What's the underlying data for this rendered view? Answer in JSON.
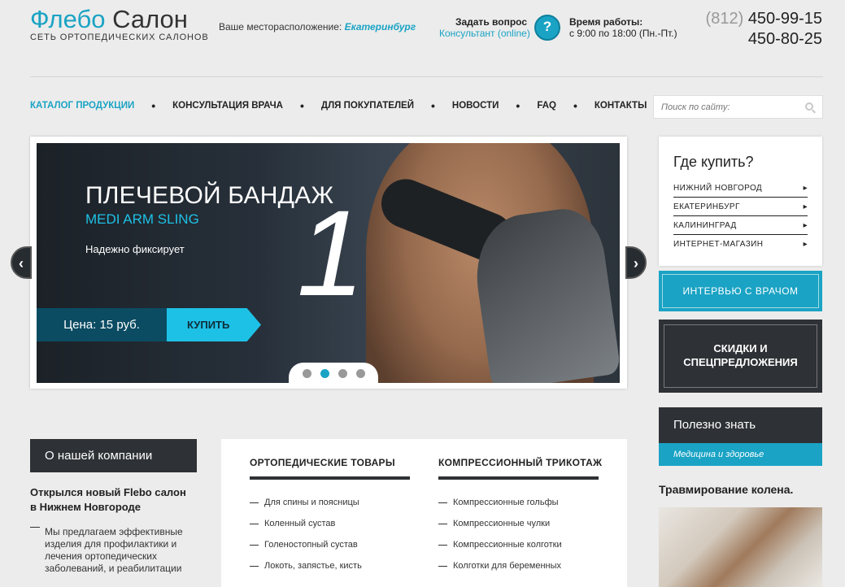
{
  "header": {
    "brand_part1": "Флебо",
    "brand_part2": "Салон",
    "tagline": "СЕТЬ ОРТОПЕДИЧЕСКИХ САЛОНОВ",
    "location_label": "Ваше месторасположение:",
    "location_city": "Екатеринбург",
    "ask_title": "Задать вопрос",
    "ask_subtitle": "Консультант (online)",
    "hours_title": "Время работы:",
    "hours_value": "с 9:00 по 18:00 (Пн.-Пт.)",
    "phone_code": "(812)",
    "phone1": "450-99-15",
    "phone2": "450-80-25"
  },
  "nav": {
    "items": [
      "КАТАЛОГ ПРОДУКЦИИ",
      "КОНСУЛЬТАЦИЯ ВРАЧА",
      "ДЛЯ ПОКУПАТЕЛЕЙ",
      "НОВОСТИ",
      "FAQ",
      "КОНТАКТЫ"
    ],
    "separator": "•"
  },
  "search": {
    "placeholder": "Поиск по сайту:",
    "icon": "search-icon"
  },
  "slider": {
    "title": "ПЛЕЧЕВОЙ БАНДАЖ",
    "subtitle": "MEDI ARM SLING",
    "description": "Надежно фиксирует",
    "number": "1",
    "price": "Цена: 15 руб.",
    "buy_label": "КУПИТЬ",
    "prev_arrow": "‹",
    "next_arrow": "›",
    "active_dot": 2,
    "dot_count": 4
  },
  "where_to_buy": {
    "title": "Где купить?",
    "items": [
      "НИЖНИЙ НОВГОРОД",
      "ЕКАТЕРИНБУРГ",
      "КАЛИНИНГРАД",
      "ИНТЕРНЕТ-МАГАЗИН"
    ]
  },
  "interview_label": "ИНТЕРВЬЮ С ВРАЧОМ",
  "discounts_label": "СКИДКИ И СПЕЦПРЕДЛОЖЕНИЯ",
  "useful": {
    "title": "Полезно знать",
    "subtitle": "Медицина и здоровье"
  },
  "trauma_title": "Травмирование колена.",
  "about": {
    "label": "О нашей компании",
    "news_title_line1": "Открылся новый Flebo салон",
    "news_title_line2": "в Нижнем Новгороде",
    "news_text": "Мы предлагаем эффективные изделия для профилактики и лечения ортопедических заболеваний, и реабилитации"
  },
  "products": {
    "col1": {
      "title": "ОРТОПЕДИЧЕСКИЕ ТОВАРЫ",
      "items": [
        "Для спины и поясницы",
        "Коленный сустав",
        "Голеностопный сустав",
        "Локоть, запястье, кисть"
      ]
    },
    "col2": {
      "title": "КОМПРЕССИОННЫЙ ТРИКОТАЖ",
      "items": [
        "Компрессионные гольфы",
        "Компрессионные чулки",
        "Компрессионные колготки",
        "Колготки для беременных"
      ]
    }
  },
  "colors": {
    "accent": "#1aa3c4",
    "dark": "#2e3135",
    "price_bg": "#0b4c63",
    "buy_bg": "#1ec1e6"
  }
}
